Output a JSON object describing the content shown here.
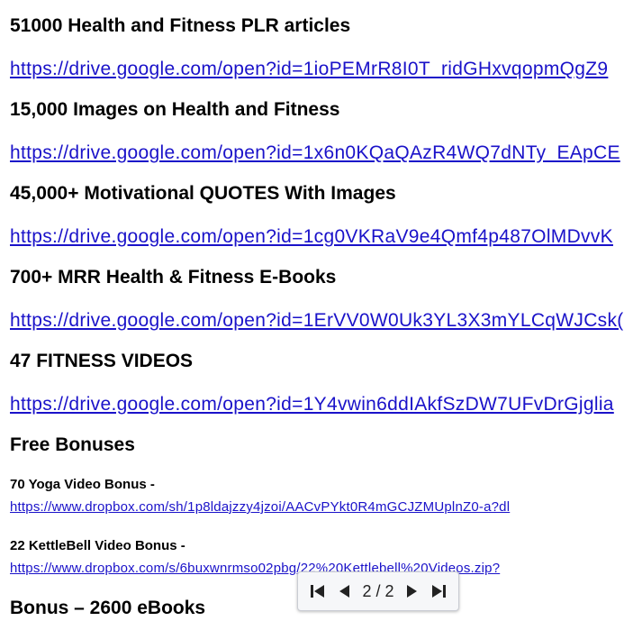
{
  "sections": [
    {
      "title": "51000 Health and Fitness PLR articles",
      "url": "https://drive.google.com/open?id=1ioPEMrR8I0T_ridGHxvqopmQgZ9"
    },
    {
      "title": "15,000 Images on Health and Fitness",
      "url": "https://drive.google.com/open?id=1x6n0KQaQAzR4WQ7dNTy_EApCE"
    },
    {
      "title": "45,000+ Motivational QUOTES With Images",
      "url": "https://drive.google.com/open?id=1cg0VKRaV9e4Qmf4p487OlMDvvK"
    },
    {
      "title": "700+ MRR Health & Fitness E-Books",
      "url": "https://drive.google.com/open?id=1ErVV0W0Uk3YL3X3mYLCqWJCsk("
    },
    {
      "title": "47 FITNESS VIDEOS",
      "url": "https://drive.google.com/open?id=1Y4vwin6ddIAkfSzDW7UFvDrGjglia"
    }
  ],
  "free_bonuses_heading": "Free Bonuses",
  "bonuses": [
    {
      "title": "70 Yoga Video Bonus -",
      "url": "https://www.dropbox.com/sh/1p8ldajzzy4jzoi/AACvPYkt0R4mGCJZMUplnZ0-a?dl"
    },
    {
      "title": "22 KettleBell Video Bonus -",
      "url": "https://www.dropbox.com/s/6buxwnrmso02pbg/22%20Kettlebell%20Videos.zip?"
    }
  ],
  "last_heading": "Bonus – 2600 eBooks",
  "pager": {
    "label": "2 / 2"
  },
  "icons": {
    "first": "first-page-icon",
    "prev": "previous-page-icon",
    "next": "next-page-icon",
    "last": "last-page-icon"
  },
  "colors": {
    "link": "#1a12c9"
  }
}
